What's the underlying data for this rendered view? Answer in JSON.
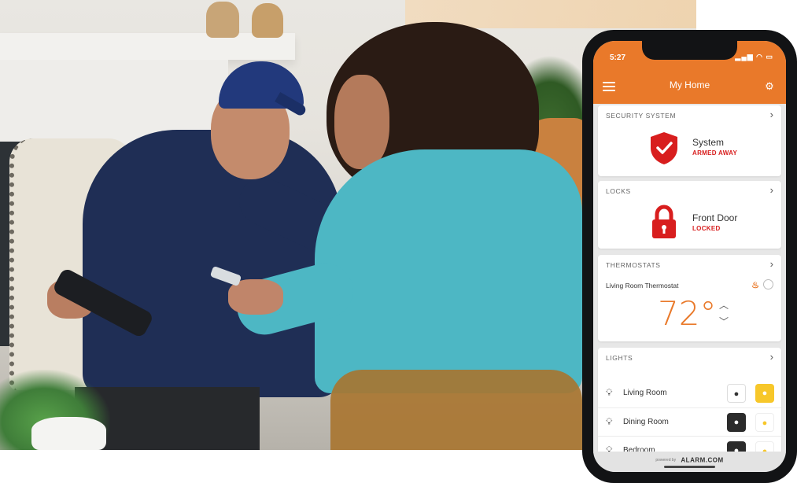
{
  "status_bar": {
    "time": "5:27"
  },
  "header": {
    "title": "My Home"
  },
  "security": {
    "label": "SECURITY SYSTEM",
    "name": "System",
    "status": "ARMED AWAY"
  },
  "locks": {
    "label": "LOCKS",
    "name": "Front Door",
    "status": "LOCKED"
  },
  "thermostats": {
    "label": "THERMOSTATS",
    "name": "Living Room Thermostat",
    "temperature": "72°"
  },
  "lights": {
    "label": "LIGHTS",
    "items": [
      {
        "label": "Living Room"
      },
      {
        "label": "Dining Room"
      },
      {
        "label": "Bedroom"
      }
    ]
  },
  "footer": {
    "brand": "ALARM.COM"
  },
  "colors": {
    "accent": "#e9792a",
    "alert": "#d81e1e",
    "light_on": "#f7c72a"
  }
}
